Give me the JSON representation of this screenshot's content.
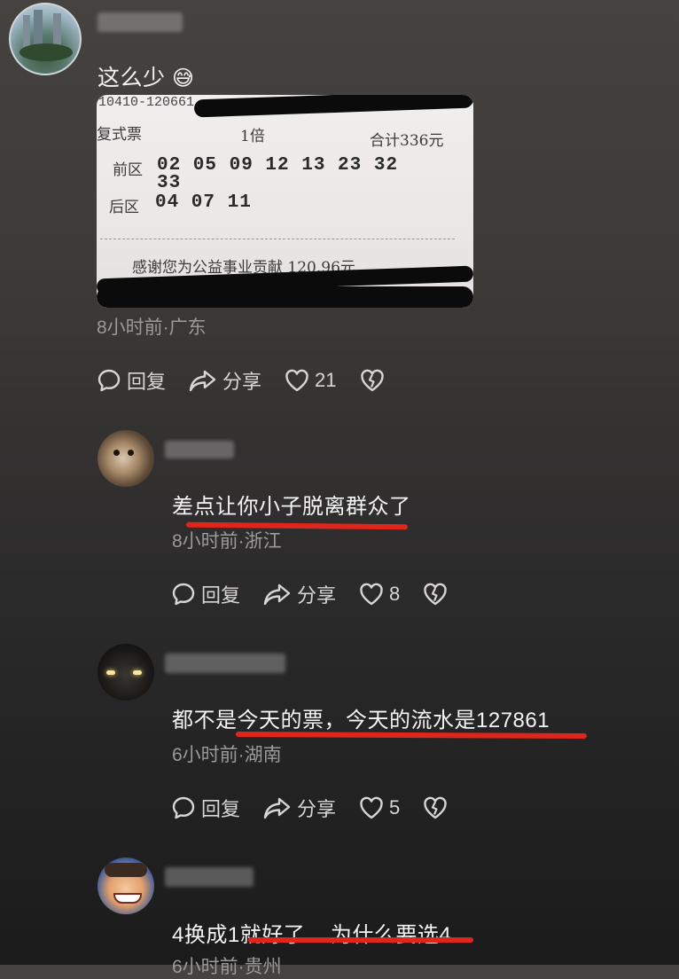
{
  "comment1": {
    "text": "这么少",
    "emoji": "😅",
    "meta": "8小时前·广东",
    "reply_label": "回复",
    "share_label": "分享",
    "like_count": "21",
    "ticket": {
      "serial": "10410-120661",
      "type_label": "复式票",
      "multiple": "1倍",
      "total": "合计336元",
      "front_label": "前区",
      "front_numbers": "02 05 09 12 13 23 32",
      "front_numbers_2": "33",
      "back_label": "后区",
      "back_numbers": "04 07 11",
      "contribution": "感谢您为公益事业贡献 120.96元"
    }
  },
  "comment2": {
    "text": "差点让你小子脱离群众了",
    "meta": "8小时前·浙江",
    "reply_label": "回复",
    "share_label": "分享",
    "like_count": "8"
  },
  "comment3": {
    "text": "都不是今天的票，今天的流水是127861",
    "meta": "6小时前·湖南",
    "reply_label": "回复",
    "share_label": "分享",
    "like_count": "5"
  },
  "comment4": {
    "text": "4换成1就好了    为什么要选4",
    "meta": "6小时前·贵州"
  },
  "colors": {
    "underline": "#e0261b",
    "meta_text": "#9c9a98"
  }
}
